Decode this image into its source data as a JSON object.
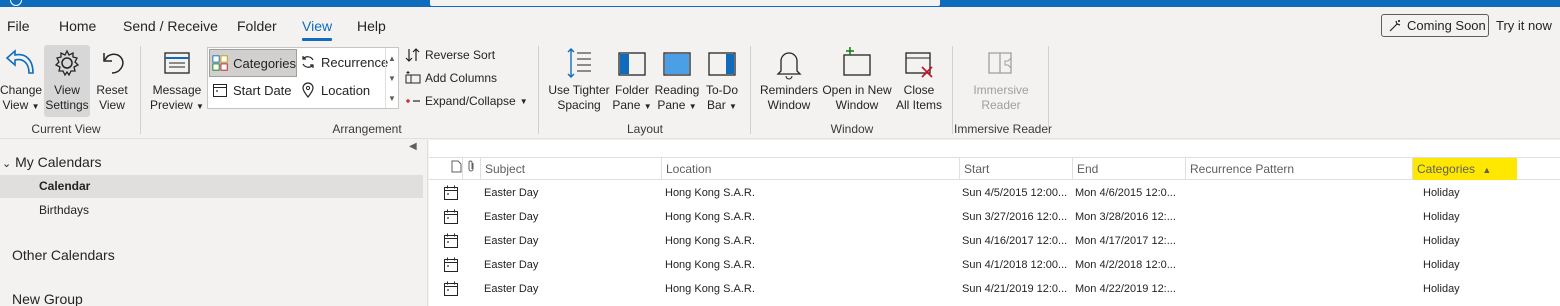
{
  "menubar": {
    "items": [
      {
        "label": "File",
        "active": false
      },
      {
        "label": "Home",
        "active": false
      },
      {
        "label": "Send / Receive",
        "active": false
      },
      {
        "label": "Folder",
        "active": false
      },
      {
        "label": "View",
        "active": true
      },
      {
        "label": "Help",
        "active": false
      }
    ],
    "coming_soon": "Coming Soon",
    "try_now": "Try it now"
  },
  "ribbon": {
    "current_view": {
      "label": "Current View",
      "change_view": [
        "Change",
        "View"
      ],
      "view_settings": [
        "View",
        "Settings"
      ],
      "reset_view": [
        "Reset",
        "View"
      ]
    },
    "arrangement": {
      "label": "Arrangement",
      "message_preview": [
        "Message",
        "Preview"
      ],
      "categories": "Categories",
      "recurrence": "Recurrence",
      "start_date": "Start Date",
      "location": "Location",
      "reverse_sort": "Reverse Sort",
      "add_columns": "Add Columns",
      "expand_collapse": "Expand/Collapse"
    },
    "layout": {
      "label": "Layout",
      "use_tighter_spacing": [
        "Use Tighter",
        "Spacing"
      ],
      "folder_pane": [
        "Folder",
        "Pane"
      ],
      "reading_pane": [
        "Reading",
        "Pane"
      ],
      "todo_bar": [
        "To-Do",
        "Bar"
      ]
    },
    "window": {
      "label": "Window",
      "reminders_window": [
        "Reminders",
        "Window"
      ],
      "open_in_new_window": [
        "Open in New",
        "Window"
      ],
      "close_all_items": [
        "Close",
        "All Items"
      ]
    },
    "immersive_reader": {
      "label": "Immersive Reader",
      "button": [
        "Immersive",
        "Reader"
      ]
    }
  },
  "sidebar": {
    "my_calendars": "My Calendars",
    "items": [
      "Calendar",
      "Birthdays"
    ],
    "other_calendars": "Other Calendars",
    "new_group": "New Group"
  },
  "table": {
    "columns": [
      "Subject",
      "Location",
      "Start",
      "End",
      "Recurrence Pattern",
      "Categories"
    ],
    "rows": [
      {
        "subject": "Easter Day",
        "location": "Hong Kong S.A.R.",
        "start": "Sun 4/5/2015 12:00...",
        "end": "Mon 4/6/2015 12:0...",
        "recurrence": "",
        "categories": "Holiday"
      },
      {
        "subject": "Easter Day",
        "location": "Hong Kong S.A.R.",
        "start": "Sun 3/27/2016 12:0...",
        "end": "Mon 3/28/2016 12:...",
        "recurrence": "",
        "categories": "Holiday"
      },
      {
        "subject": "Easter Day",
        "location": "Hong Kong S.A.R.",
        "start": "Sun 4/16/2017 12:0...",
        "end": "Mon 4/17/2017 12:...",
        "recurrence": "",
        "categories": "Holiday"
      },
      {
        "subject": "Easter Day",
        "location": "Hong Kong S.A.R.",
        "start": "Sun 4/1/2018 12:00...",
        "end": "Mon 4/2/2018 12:0...",
        "recurrence": "",
        "categories": "Holiday"
      },
      {
        "subject": "Easter Day",
        "location": "Hong Kong S.A.R.",
        "start": "Sun 4/21/2019 12:0...",
        "end": "Mon 4/22/2019 12:...",
        "recurrence": "",
        "categories": "Holiday"
      }
    ]
  },
  "colors": {
    "accent": "#0f6cbd",
    "highlight": "#ffe800",
    "selected_bg": "#e1dfdd"
  },
  "icons": {
    "change_view": "undo-arrow-icon",
    "view_settings": "gear-icon",
    "reset_view": "reset-arrow-icon",
    "calendar_row": "calendar-icon"
  }
}
